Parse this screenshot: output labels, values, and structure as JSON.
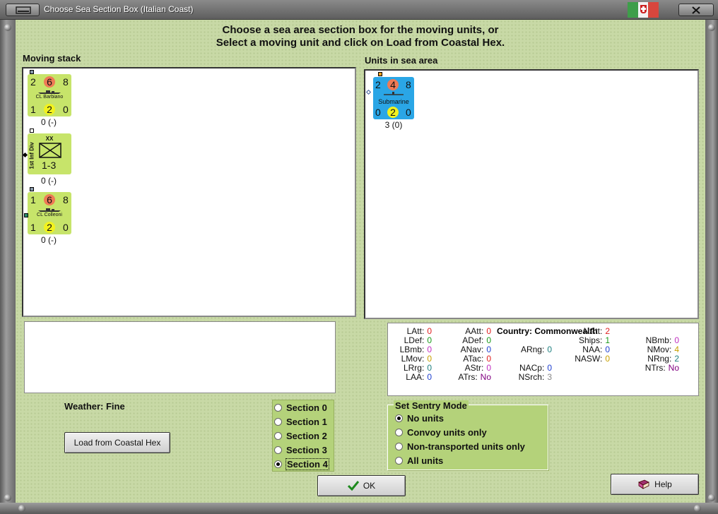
{
  "window": {
    "title": "Choose Sea Section Box (Italian Coast)",
    "flag_colors": [
      "#3e9e4a",
      "#f2f2f2",
      "#d8463d"
    ]
  },
  "instructions": {
    "line1": "Choose a sea area section box for the moving units, or",
    "line2": "Select a moving unit and click on Load from Coastal Hex."
  },
  "moving_stack": {
    "label": "Moving stack",
    "units": [
      {
        "type": "ship",
        "left": "2",
        "center": "6",
        "right": "8",
        "name": "CL Barbiano",
        "b_left": "1",
        "b_center": "2",
        "b_right": "0",
        "under": "0 (-)"
      },
      {
        "type": "division",
        "top": "XX",
        "name": "1st Inf Div",
        "strength": "1-3",
        "under": "0 (-)"
      },
      {
        "type": "ship",
        "left": "1",
        "center": "6",
        "right": "8",
        "name": "CL Colleoni",
        "b_left": "1",
        "b_center": "2",
        "b_right": "0",
        "under": "0 (-)"
      }
    ]
  },
  "sea_area": {
    "label": "Units in sea area",
    "units": [
      {
        "type": "submarine",
        "left": "2",
        "center": "4",
        "right": "8",
        "name": "Submarine",
        "b_left": "0",
        "b_center": "2",
        "b_right": "0",
        "under": "3 (0)"
      }
    ]
  },
  "stats": {
    "country_label": "Country:",
    "country": "Commonwealth",
    "col1": [
      {
        "label": "LAtt:",
        "value": "0",
        "color": "#e02020"
      },
      {
        "label": "LDef:",
        "value": "0",
        "color": "#1a9a1a"
      },
      {
        "label": "LBmb:",
        "value": "0",
        "color": "#c030c0"
      },
      {
        "label": "LMov:",
        "value": "0",
        "color": "#c8a000"
      },
      {
        "label": "LRrg:",
        "value": "0",
        "color": "#208080"
      },
      {
        "label": "LAA:",
        "value": "0",
        "color": "#2040d0"
      }
    ],
    "col2": [
      {
        "label": "AAtt:",
        "value": "0",
        "color": "#e02020"
      },
      {
        "label": "ADef:",
        "value": "0",
        "color": "#1a9a1a"
      },
      {
        "label": "ANav:",
        "value": "0",
        "color": "#2040d0"
      },
      {
        "label": "ATac:",
        "value": "0",
        "color": "#e02020"
      },
      {
        "label": "AStr:",
        "value": "0",
        "color": "#c030c0"
      },
      {
        "label": "ATrs:",
        "value": "No",
        "color": "#800080"
      }
    ],
    "col3": [
      {
        "label": "ARng:",
        "value": "0",
        "color": "#208080",
        "row": 2
      },
      {
        "label": "NACp:",
        "value": "0",
        "color": "#2040d0",
        "row": 4
      },
      {
        "label": "NSrch:",
        "value": "3",
        "color": "#888888",
        "row": 5
      }
    ],
    "col4": [
      {
        "label": "NAtt:",
        "value": "2",
        "color": "#e02020",
        "row": 0
      },
      {
        "label": "Ships:",
        "value": "1",
        "color": "#1a9a1a",
        "row": 1
      },
      {
        "label": "NAA:",
        "value": "0",
        "color": "#2040d0",
        "row": 2
      },
      {
        "label": "NASW:",
        "value": "0",
        "color": "#c8a000",
        "row": 3
      }
    ],
    "col5": [
      {
        "label": "NBmb:",
        "value": "0",
        "color": "#c030c0"
      },
      {
        "label": "NMov:",
        "value": "4",
        "color": "#c8a000"
      },
      {
        "label": "NRng:",
        "value": "2",
        "color": "#208080"
      },
      {
        "label": "NTrs:",
        "value": "No",
        "color": "#800080"
      }
    ]
  },
  "weather": "Weather: Fine",
  "load_button": "Load from Coastal Hex",
  "sections": [
    {
      "label": "Section 0",
      "selected": false
    },
    {
      "label": "Section 1",
      "selected": false
    },
    {
      "label": "Section 2",
      "selected": false
    },
    {
      "label": "Section 3",
      "selected": false
    },
    {
      "label": "Section 4",
      "selected": true
    }
  ],
  "sentry": {
    "label": "Set Sentry Mode",
    "options": [
      {
        "label": "No units",
        "selected": true
      },
      {
        "label": "Convoy units only",
        "selected": false
      },
      {
        "label": "Non-transported units only",
        "selected": false
      },
      {
        "label": "All units",
        "selected": false
      }
    ]
  },
  "ok_button": "OK",
  "help_button": "Help",
  "colors": {
    "ship_counter": "#c7e46a",
    "sub_counter": "#2aa6e6",
    "attack_circle": "#ee7a55",
    "defense_circle": "#f2f21e"
  }
}
